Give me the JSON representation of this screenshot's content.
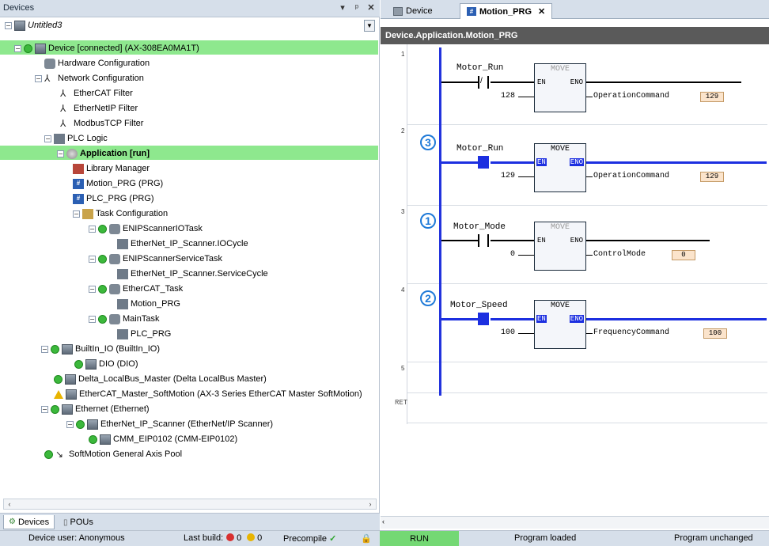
{
  "devices_panel": {
    "title": "Devices",
    "root_label": "Untitled3",
    "tree": [
      {
        "label": "Device [connected] (AX-308EA0MA1T)",
        "bold": false
      },
      {
        "label": "Hardware Configuration"
      },
      {
        "label": "Network Configuration"
      },
      {
        "label": "EtherCAT Filter"
      },
      {
        "label": "EtherNetIP Filter"
      },
      {
        "label": "ModbusTCP Filter"
      },
      {
        "label": "PLC Logic"
      },
      {
        "label": "Application [run]"
      },
      {
        "label": "Library Manager"
      },
      {
        "label": "Motion_PRG (PRG)"
      },
      {
        "label": "PLC_PRG (PRG)"
      },
      {
        "label": "Task Configuration"
      },
      {
        "label": "ENIPScannerIOTask"
      },
      {
        "label": "EtherNet_IP_Scanner.IOCycle"
      },
      {
        "label": "ENIPScannerServiceTask"
      },
      {
        "label": "EtherNet_IP_Scanner.ServiceCycle"
      },
      {
        "label": "EtherCAT_Task"
      },
      {
        "label": "Motion_PRG"
      },
      {
        "label": "MainTask"
      },
      {
        "label": "PLC_PRG"
      },
      {
        "label": "BuiltIn_IO (BuiltIn_IO)"
      },
      {
        "label": "DIO (DIO)"
      },
      {
        "label": "Delta_LocalBus_Master (Delta LocalBus Master)"
      },
      {
        "label": "EtherCAT_Master_SoftMotion (AX-3 Series EtherCAT Master SoftMotion)"
      },
      {
        "label": "Ethernet (Ethernet)"
      },
      {
        "label": "EtherNet_IP_Scanner (EtherNet/IP Scanner)"
      },
      {
        "label": "CMM_EIP0102 (CMM-EIP0102)"
      },
      {
        "label": "SoftMotion General Axis Pool"
      }
    ],
    "bottom_tabs": [
      "Devices",
      "POUs"
    ]
  },
  "editor": {
    "tabs": [
      "Device",
      "Motion_PRG"
    ],
    "path": "Device.Application.Motion_PRG",
    "ret_label": "RET",
    "networks": [
      {
        "number": "1",
        "contact": "Motor_Run",
        "block": "MOVE",
        "en": "EN",
        "eno": "ENO",
        "input": "128",
        "output": "OperationCommand",
        "output_value": "129"
      },
      {
        "number": "2",
        "badge": "3",
        "contact": "Motor_Run",
        "block": "MOVE",
        "en": "EN",
        "eno": "ENO",
        "input": "129",
        "output": "OperationCommand",
        "output_value": "129"
      },
      {
        "number": "3",
        "badge": "1",
        "contact": "Motor_Mode",
        "block": "MOVE",
        "en": "EN",
        "eno": "ENO",
        "input": "0",
        "output": "ControlMode",
        "output_value": "0"
      },
      {
        "number": "4",
        "badge": "2",
        "contact": "Motor_Speed",
        "block": "MOVE",
        "en": "EN",
        "eno": "ENO",
        "input": "100",
        "output": "FrequencyCommand",
        "output_value": "100"
      },
      {
        "number": "5"
      }
    ]
  },
  "status_bar": {
    "user": "Device user: Anonymous",
    "last_build": "Last build:",
    "errors": "0",
    "warnings": "0",
    "precompile": "Precompile",
    "run": "RUN",
    "program_loaded": "Program loaded",
    "program_unchanged": "Program unchanged"
  },
  "colors": {
    "highlight_green": "#8ee88e",
    "power_flow_blue": "#1c2fe0",
    "badge_blue": "#1f7ad8",
    "output_box": "#fbe4cc",
    "run_green": "#74d874"
  }
}
